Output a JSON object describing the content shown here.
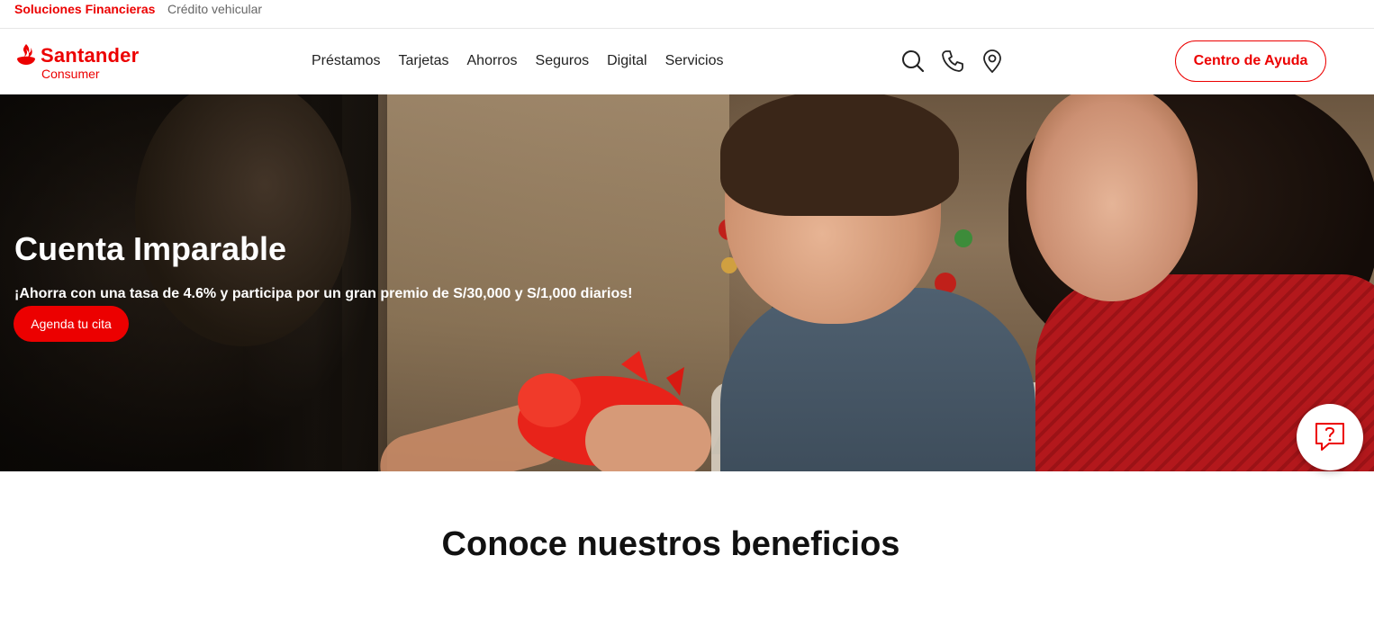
{
  "topbar": {
    "tabs": [
      {
        "label": "Soluciones Financieras",
        "active": true
      },
      {
        "label": "Crédito vehicular",
        "active": false
      }
    ]
  },
  "header": {
    "logo": {
      "brand": "Santander",
      "sub": "Consumer"
    },
    "nav": [
      {
        "label": "Préstamos"
      },
      {
        "label": "Tarjetas"
      },
      {
        "label": "Ahorros"
      },
      {
        "label": "Seguros"
      },
      {
        "label": "Digital"
      },
      {
        "label": "Servicios"
      }
    ],
    "icons": [
      "search-icon",
      "phone-icon",
      "location-pin-icon"
    ],
    "help_button": "Centro de Ayuda"
  },
  "hero": {
    "title": "Cuenta Imparable",
    "description": "¡Ahorra con una tasa de 4.6% y participa por un gran premio de S/30,000 y S/1,000 diarios!",
    "cta": "Agenda tu cita"
  },
  "chat": {
    "icon": "question-bubble-icon"
  },
  "section": {
    "title": "Conoce nuestros beneficios"
  },
  "colors": {
    "brand_red": "#ec0000",
    "text_dark": "#222222",
    "white": "#ffffff"
  }
}
